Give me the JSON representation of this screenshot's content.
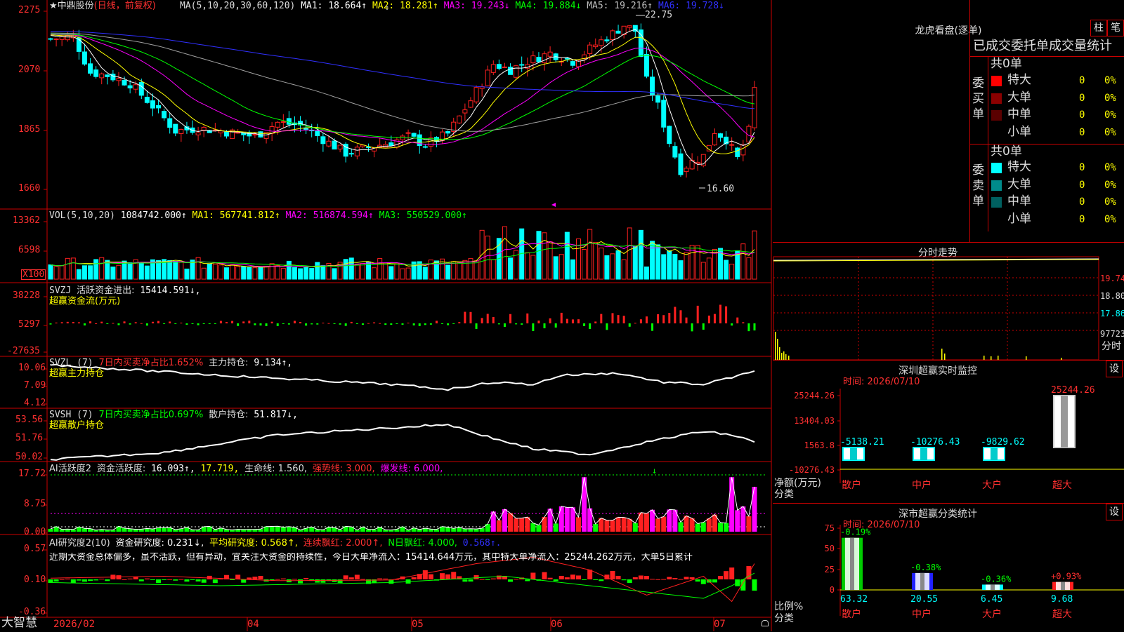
{
  "main_chart": {
    "header": {
      "star": "★",
      "stock_name": "中鼎股份",
      "period": "(日线，前复权)",
      "ma_params": "MA(5,10,20,30,60,120)",
      "ma1": "MA1: 18.664↑",
      "ma2": "MA2: 18.281↑",
      "ma3": "MA3: 19.243↓",
      "ma4": "MA4: 19.884↓",
      "ma5": "MA5: 19.216↑",
      "ma6": "MA6: 19.728↓"
    },
    "y_ticks": [
      "2275",
      "2070",
      "1865",
      "1660"
    ],
    "high_label": "22.75",
    "low_label": "16.60",
    "colors": {
      "up": "#ff2020",
      "down": "#00ffff",
      "ma1": "#ffffff",
      "ma2": "#ffff00",
      "ma3": "#ff00ff",
      "ma4": "#00ff00",
      "ma5": "#a0a0a0",
      "ma6": "#3030ff"
    }
  },
  "volume_chart": {
    "header": {
      "label": "VOL(5,10,20)",
      "value": "1084742.000↑",
      "ma1": "MA1: 567741.812↑",
      "ma2": "MA2: 516874.594↑",
      "ma3": "MA3: 550529.000↑"
    },
    "y_ticks": [
      "13362",
      "6598"
    ],
    "unit": "X100"
  },
  "svzj_chart": {
    "header": {
      "label": "SVZJ",
      "name": "活跃资金进出:",
      "value": "15414.591↓,"
    },
    "subtitle": "超赢资金流(万元)",
    "y_ticks": [
      "38228",
      "5297",
      "-27635"
    ]
  },
  "svzl_chart": {
    "header": {
      "label": "SVZL (7)",
      "ratio": "7日内买卖净占比1.652%",
      "name": "主力持仓:",
      "value": "9.134↑,"
    },
    "subtitle": "超赢主力持仓",
    "y_ticks": [
      "10.06",
      "7.09",
      "4.12"
    ]
  },
  "svsh_chart": {
    "header": {
      "label": "SVSH (7)",
      "ratio": "7日内买卖净占比0.697%",
      "name": "散户持仓:",
      "value": "51.817↓,"
    },
    "subtitle": "超赢散户持仓",
    "y_ticks": [
      "53.56",
      "51.76",
      "50.02"
    ]
  },
  "activity_chart": {
    "header": {
      "label": "AI活跃度2",
      "name": "资金活跃度:",
      "v1": "16.093↑,",
      "v2": "17.719,",
      "life": "生命线: 1.560,",
      "strong": "强势线: 3.000,",
      "burst": "爆发线: 6.000,"
    },
    "y_ticks": [
      "17.72",
      "8.75",
      "0.00"
    ]
  },
  "research_chart": {
    "header": {
      "label": "AI研究度2(10)",
      "name": "资金研究度: 0.231↓,",
      "avg": "平均研究度: 0.568↑,",
      "red": "连续飘红: 2.000↑,",
      "nred": "N日飘红: 4.000,",
      "val": "0.568↑."
    },
    "comment": "近期大资金总体偏多，虽不活跃，但有异动，宜关注大资金的持续性，今日大单净流入：15414.644万元，其中特大单净流入：25244.262万元，大单5日累计",
    "y_ticks": [
      "0.57",
      "0.10",
      "-0.36"
    ]
  },
  "bottom_bar": {
    "brand": "大智慧",
    "dates": [
      "2026/02",
      "04",
      "05",
      "06",
      "07"
    ]
  },
  "dragon_tiger": {
    "title": "龙虎看盘(逐单)",
    "btn_bar": "柱",
    "btn_pen": "笔",
    "subtitle": "已成交委托单成交量统计",
    "buy": {
      "side_label": "委买单",
      "total": "共0单",
      "rows": [
        {
          "name": "特大",
          "count": "0",
          "pct": "0%",
          "color": "#ff0000"
        },
        {
          "name": "大单",
          "count": "0",
          "pct": "0%",
          "color": "#8b0000"
        },
        {
          "name": "中单",
          "count": "0",
          "pct": "0%",
          "color": "#5a0000"
        },
        {
          "name": "小单",
          "count": "0",
          "pct": "0%",
          "color": "#000000"
        }
      ]
    },
    "sell": {
      "side_label": "委卖单",
      "total": "共0单",
      "rows": [
        {
          "name": "特大",
          "count": "0",
          "pct": "0%",
          "color": "#00ffff"
        },
        {
          "name": "大单",
          "count": "0",
          "pct": "0%",
          "color": "#008b8b"
        },
        {
          "name": "中单",
          "count": "0",
          "pct": "0%",
          "color": "#006060"
        },
        {
          "name": "小单",
          "count": "0",
          "pct": "0%",
          "color": "#000000"
        }
      ]
    }
  },
  "intraday": {
    "title": "分时走势",
    "y_ticks": [
      "19.74",
      "18.80",
      "17.86"
    ],
    "vol_label": "97723",
    "time_label": "分时"
  },
  "realtime_monitor": {
    "title": "深圳超赢实时监控",
    "btn_settings": "设",
    "date": "时间: 2026/07/10",
    "y_ticks": [
      "25244.26",
      "13404.03",
      "1563.8",
      "-10276.43"
    ],
    "axis_label": "净额(万元)",
    "category_label": "分类",
    "categories": [
      "散户",
      "中户",
      "大户",
      "超大"
    ],
    "values": [
      -5138.21,
      -10276.43,
      -9829.62,
      25244.26
    ],
    "value_labels": [
      "-5138.21",
      "-10276.43",
      "-9829.62",
      "25244.26"
    ]
  },
  "class_stats": {
    "title": "深市超赢分类统计",
    "btn_settings": "设",
    "date": "时间: 2026/07/10",
    "y_ticks": [
      "75",
      "50",
      "25",
      "0"
    ],
    "axis_label": "比例%",
    "category_label": "分类",
    "categories": [
      "散户",
      "中户",
      "大户",
      "超大"
    ],
    "values": [
      63.32,
      20.55,
      6.45,
      9.68
    ],
    "value_labels": [
      "63.32",
      "20.55",
      "6.45",
      "9.68"
    ],
    "change_labels": [
      "-0.19%",
      "-0.38%",
      "-0.36%",
      "+0.93%"
    ],
    "bar_colors": [
      "#00cc00",
      "#2020ff",
      "#00ffff",
      "#ff2020"
    ]
  }
}
